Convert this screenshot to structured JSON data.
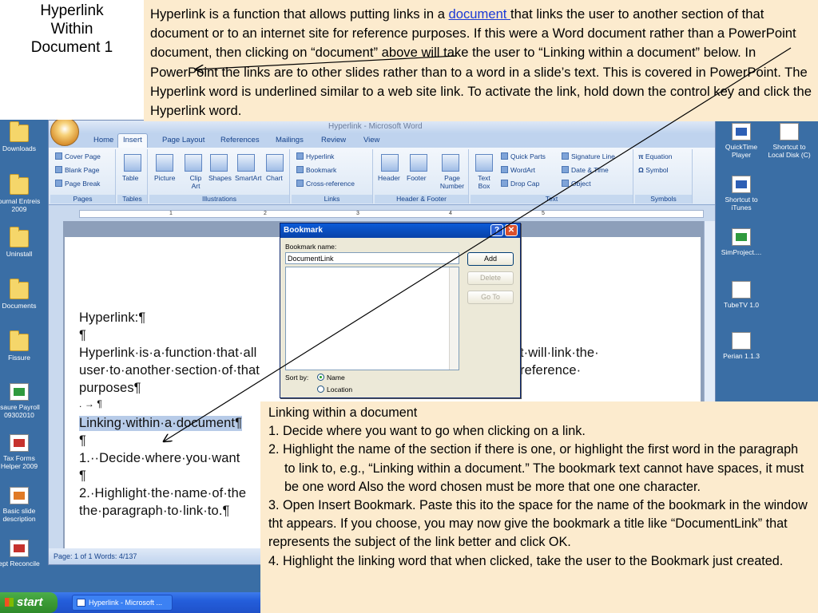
{
  "slide": {
    "title_lines": [
      "Hyperlink",
      "Within",
      "Document 1"
    ],
    "intro": {
      "before_link": "Hyperlink is a function that allows putting links in a ",
      "link_text": "document ",
      "after_link": "that links the user to another section of that document or to an internet site for reference purposes. If this were a Word document rather than a PowerPoint document, then clicking on “document” above will take the user to  “Linking within a document” below. In PowerPoint the links are to other slides rather than to a word in a slide’s text. This is covered in PowerPoint. The Hyperlink word is underlined similar to a web site link. To activate the link, hold down the control key and click the Hyperlink word."
    },
    "steps_heading": "Linking within a document",
    "steps": [
      "1.  Decide where you want to go when clicking on a link.",
      "2. Highlight the name of the section if there is one, or highlight the first word in the paragraph to link to, e.g., “Linking within a document.” The bookmark text cannot have spaces, it must be one word Also the word chosen must be more that one one character.",
      "3. Open Insert Bookmark. Paste this ito the space for the name of the bookmark in the window tht appears. If you choose, you may now give the bookmark a title like “DocumentLink” that represents the subject of the link better and click OK.",
      "4. Highlight the linking word that when clicked, take the user to the Bookmark just created."
    ]
  },
  "desktop": {
    "left_icons": [
      "Downloads",
      "ournal Entreis 2009",
      "Uninstall",
      "Documents",
      "Fissure",
      "isaure Payroll 09302010",
      "Tax Forms Helper 2009",
      "Basic slide description",
      "ept Reconcile"
    ],
    "right_icons": [
      "QuickTime Player",
      "Shortcut to Local Disk (C)",
      "Shortcut to iTunes",
      "SimProject....",
      "TubeTV 1.0",
      "Perian 1.1.3"
    ]
  },
  "taskbar": {
    "start_label": "start",
    "task_label": "Hyperlink - Microsoft ..."
  },
  "word": {
    "window_title": "Hyperlink - Microsoft Word",
    "tabs": [
      "Home",
      "Insert",
      "Page Layout",
      "References",
      "Mailings",
      "Review",
      "View"
    ],
    "active_tab": "Insert",
    "ribbon": {
      "pages": {
        "label": "Pages",
        "items": [
          "Cover Page",
          "Blank Page",
          "Page Break"
        ]
      },
      "tables": {
        "label": "Tables",
        "items": [
          "Table"
        ]
      },
      "illustrations": {
        "label": "Illustrations",
        "items": [
          "Picture",
          "Clip Art",
          "Shapes",
          "SmartArt",
          "Chart"
        ]
      },
      "links": {
        "label": "Links",
        "items": [
          "Hyperlink",
          "Bookmark",
          "Cross-reference"
        ]
      },
      "header_footer": {
        "label": "Header & Footer",
        "items": [
          "Header",
          "Footer",
          "Page Number"
        ]
      },
      "text": {
        "label": "Text",
        "items": [
          "Text Box",
          "Quick Parts",
          "WordArt",
          "Drop Cap",
          "Signature Line",
          "Date & Time",
          "Object"
        ]
      },
      "symbols": {
        "label": "Symbols",
        "items": [
          "Equation",
          "Symbol"
        ]
      }
    },
    "doc_lines": [
      "Hyperlink:¶",
      "¶",
      "Hyperlink·is·a·function·that·all",
      "user·to·another·section·of·that",
      "purposes¶",
      ".     →     ¶",
      "Linking·within·a·document¶",
      "¶",
      "1.··Decide·where·you·want",
      "¶",
      "2.·Highlight·the·name·of·the",
      "the·paragraph·to·link·to.¶"
    ],
    "doc_right_fragments": [
      "t·will·link·the·",
      "reference·"
    ],
    "status": "Page: 1 of 1   Words: 4/137",
    "ruler_marks": [
      "1",
      "2",
      "3",
      "4",
      "5"
    ]
  },
  "dialog": {
    "title": "Bookmark",
    "name_label": "Bookmark name:",
    "name_value": "DocumentLink",
    "buttons": {
      "add": "Add",
      "delete": "Delete",
      "goto": "Go To"
    },
    "sort_by_label": "Sort by:",
    "sort_options": [
      "Name",
      "Location"
    ],
    "sort_selected": "Name"
  }
}
